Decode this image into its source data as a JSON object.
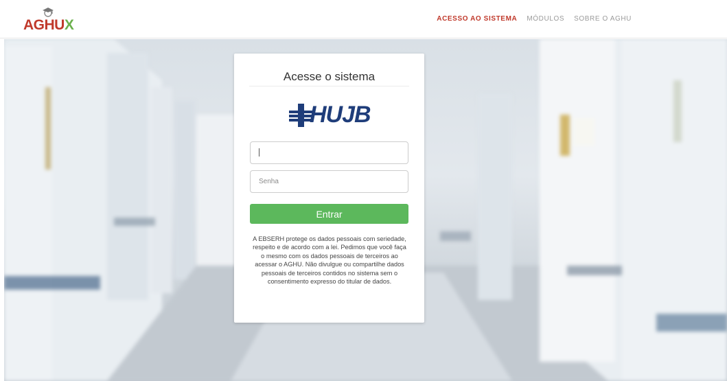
{
  "header": {
    "logo_text": "AGHUX",
    "nav": [
      {
        "label": "ACESSO AO SISTEMA",
        "active": true
      },
      {
        "label": "MÓDULOS",
        "active": false
      },
      {
        "label": "SOBRE O AGHU",
        "active": false
      }
    ]
  },
  "login": {
    "title": "Acesse o sistema",
    "hospital_logo_text": "HUJB",
    "user_field": {
      "value": "",
      "placeholder": ""
    },
    "password_field": {
      "placeholder": "Senha"
    },
    "submit_label": "Entrar",
    "notice": "A EBSERH protege os dados pessoais com seriedade, respeito e de acordo com a lei. Pedimos que você faça o mesmo com os dados pessoais de terceiros ao acessar o AGHU. Não divulgue ou compartilhe dados pessoais de terceiros contidos no sistema sem o consentimento expresso do titular de dados."
  },
  "colors": {
    "brand_red": "#c0392b",
    "brand_green": "#6ab04c",
    "button_green": "#5cb85c",
    "hujb_blue": "#1f3d7a"
  }
}
